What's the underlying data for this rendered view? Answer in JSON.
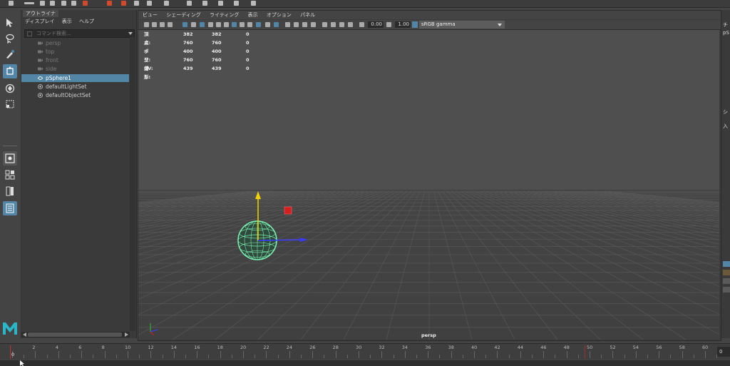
{
  "outliner": {
    "tab_label": "アウトライナ",
    "menus": [
      "ディスプレイ",
      "表示",
      "ヘルプ"
    ],
    "search_placeholder": "コマンド検索...",
    "items": [
      {
        "label": "persp",
        "icon": "camera-icon",
        "dim": true
      },
      {
        "label": "top",
        "icon": "camera-icon",
        "dim": true
      },
      {
        "label": "front",
        "icon": "camera-icon",
        "dim": true
      },
      {
        "label": "side",
        "icon": "camera-icon",
        "dim": true
      },
      {
        "label": "pSphere1",
        "icon": "mesh-icon",
        "selected": true
      },
      {
        "label": "defaultLightSet",
        "icon": "set-icon"
      },
      {
        "label": "defaultObjectSet",
        "icon": "set-icon"
      }
    ]
  },
  "viewport": {
    "menus": [
      "ビュー",
      "シェーディング",
      "ライティング",
      "表示",
      "オプション",
      "パネル"
    ],
    "exposure": "0.00",
    "gamma": "1.00",
    "color_space": "sRGB gamma",
    "camera_label": "persp",
    "hud": [
      {
        "label": "頂点:",
        "v1": "382",
        "v2": "382",
        "v3": "0"
      },
      {
        "label": "エッジ:",
        "v1": "760",
        "v2": "760",
        "v3": "0"
      },
      {
        "label": "ポリゴン:",
        "v1": "400",
        "v2": "400",
        "v3": "0"
      },
      {
        "label": "三角形:",
        "v1": "760",
        "v2": "760",
        "v3": "0"
      },
      {
        "label": "UV:",
        "v1": "439",
        "v2": "439",
        "v3": "0"
      }
    ]
  },
  "right_panel": {
    "labels": [
      "チ",
      "pS",
      "シ",
      "入"
    ]
  },
  "timeline": {
    "ticks": [
      "0",
      "2",
      "4",
      "6",
      "8",
      "10",
      "12",
      "14",
      "16",
      "18",
      "20",
      "22",
      "24",
      "26",
      "28",
      "30",
      "32",
      "34",
      "36",
      "38",
      "40",
      "42",
      "44",
      "46",
      "48",
      "50",
      "52",
      "54",
      "56",
      "58",
      "60"
    ],
    "current_frame_field": "0",
    "current_frame": "0",
    "end_marker": "50"
  },
  "colors": {
    "accent": "#5285a6",
    "sphere": "#7df0b4",
    "manip_y": "#f2d200",
    "manip_x": "#3b3bff",
    "manip_z": "#d22020"
  }
}
